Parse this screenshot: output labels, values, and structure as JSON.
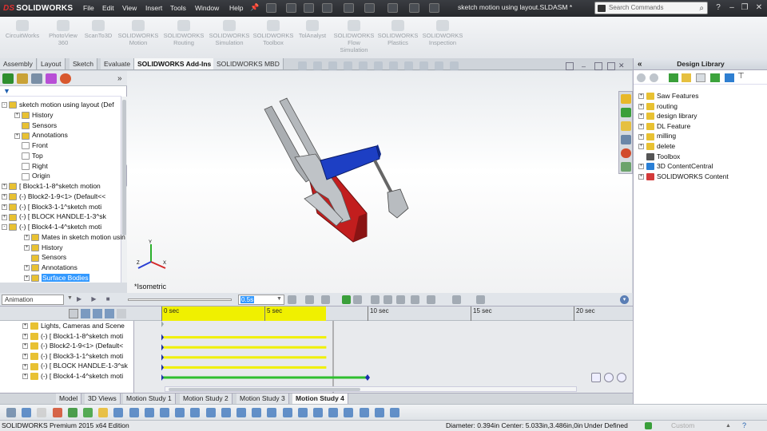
{
  "app": {
    "brand": "SOLIDWORKS",
    "brand_prefix": "DS",
    "doc_title": "sketch motion using layout.SLDASM *",
    "search_placeholder": "Search Commands",
    "menus": [
      "File",
      "Edit",
      "View",
      "Insert",
      "Tools",
      "Window",
      "Help"
    ]
  },
  "command_manager": {
    "items": [
      {
        "label1": "CircuitWorks",
        "label2": "",
        "label3": ""
      },
      {
        "label1": "PhotoView",
        "label2": "360",
        "label3": ""
      },
      {
        "label1": "ScanTo3D",
        "label2": "",
        "label3": ""
      },
      {
        "label1": "SOLIDWORKS",
        "label2": "Motion",
        "label3": ""
      },
      {
        "label1": "SOLIDWORKS",
        "label2": "Routing",
        "label3": ""
      },
      {
        "label1": "SOLIDWORKS",
        "label2": "Simulation",
        "label3": ""
      },
      {
        "label1": "SOLIDWORKS",
        "label2": "Toolbox",
        "label3": ""
      },
      {
        "label1": "TolAnalyst",
        "label2": "",
        "label3": ""
      },
      {
        "label1": "SOLIDWORKS",
        "label2": "Flow",
        "label3": "Simulation"
      },
      {
        "label1": "SOLIDWORKS",
        "label2": "Plastics",
        "label3": ""
      },
      {
        "label1": "SOLIDWORKS",
        "label2": "Inspection",
        "label3": ""
      }
    ],
    "tabs": [
      "Assembly",
      "Layout",
      "Sketch",
      "Evaluate",
      "SOLIDWORKS Add-Ins",
      "SOLIDWORKS MBD"
    ],
    "active_tab": "SOLIDWORKS Add-Ins"
  },
  "feature_tree": {
    "rows": [
      {
        "text": "sketch motion using layout  (Def",
        "indent": 0,
        "exp": "-",
        "color": "#e8c132"
      },
      {
        "text": "History",
        "indent": 1,
        "exp": "+",
        "color": "#e8c132"
      },
      {
        "text": "Sensors",
        "indent": 1,
        "exp": "",
        "color": "#e8c132"
      },
      {
        "text": "Annotations",
        "indent": 1,
        "exp": "+",
        "color": "#e8c132"
      },
      {
        "text": "Front",
        "indent": 1,
        "exp": "",
        "color": "#ffffff"
      },
      {
        "text": "Top",
        "indent": 1,
        "exp": "",
        "color": "#ffffff"
      },
      {
        "text": "Right",
        "indent": 1,
        "exp": "",
        "color": "#ffffff"
      },
      {
        "text": "Origin",
        "indent": 1,
        "exp": "",
        "color": "#ffffff"
      },
      {
        "text": "[ Block1-1-8^sketch motion",
        "indent": 0,
        "exp": "+",
        "color": "#e8c132"
      },
      {
        "text": "(-) Block2-1-9<1> (Default<<",
        "indent": 0,
        "exp": "+",
        "color": "#e8c132"
      },
      {
        "text": "(-) [ Block3-1-1^sketch moti",
        "indent": 0,
        "exp": "+",
        "color": "#e8c132"
      },
      {
        "text": "(-) [ BLOCK HANDLE-1-3^sk",
        "indent": 0,
        "exp": "+",
        "color": "#e8c132"
      },
      {
        "text": "(-) [ Block4-1-4^sketch moti",
        "indent": 0,
        "exp": "-",
        "color": "#e8c132"
      },
      {
        "text": "Mates in sketch motion usin",
        "indent": 2,
        "exp": "+",
        "color": "#e8c132"
      },
      {
        "text": "History",
        "indent": 2,
        "exp": "+",
        "color": "#e8c132"
      },
      {
        "text": "Sensors",
        "indent": 2,
        "exp": "",
        "color": "#e8c132"
      },
      {
        "text": "Annotations",
        "indent": 2,
        "exp": "+",
        "color": "#e8c132"
      },
      {
        "text": "Surface Bodies",
        "indent": 2,
        "exp": "+",
        "color": "#e8c132",
        "selected": true
      }
    ]
  },
  "viewport": {
    "view_name": "*Isometric"
  },
  "design_library": {
    "title": "Design Library",
    "items": [
      {
        "text": "Saw Features",
        "exp": "+",
        "color": "#e8c132"
      },
      {
        "text": "routing",
        "exp": "+",
        "color": "#e8c132"
      },
      {
        "text": "design library",
        "exp": "+",
        "color": "#e8c132"
      },
      {
        "text": "DL Feature",
        "exp": "+",
        "color": "#e8c132"
      },
      {
        "text": "milling",
        "exp": "+",
        "color": "#e8c132"
      },
      {
        "text": "delete",
        "exp": "+",
        "color": "#e8c132"
      },
      {
        "text": "Toolbox",
        "exp": "",
        "color": "#555555"
      },
      {
        "text": "3D ContentCentral",
        "exp": "+",
        "color": "#2a7fd6"
      },
      {
        "text": "SOLIDWORKS Content",
        "exp": "+",
        "color": "#d43a3a"
      }
    ]
  },
  "motion": {
    "study_type": "Animation",
    "speed_value": "0.5s",
    "ticks": [
      "0 sec",
      "5 sec",
      "10 sec",
      "15 sec",
      "20 sec"
    ],
    "rows": [
      "Lights, Cameras and Scene",
      "(-) [ Block1-1-8^sketch moti",
      "(-) Block2-1-9<1> (Default<",
      "(-) [ Block3-1-1^sketch moti",
      "(-) [ BLOCK HANDLE-1-3^sk",
      "(-) [ Block4-1-4^sketch moti"
    ],
    "study_tabs": [
      "Model",
      "3D Views",
      "Motion Study 1",
      "Motion Study 2",
      "Motion Study 3",
      "Motion Study 4"
    ],
    "active_study": "Motion Study 4"
  },
  "status": {
    "edition": "SOLIDWORKS Premium 2015 x64 Edition",
    "diameter": "Diameter: 0.394in  Center: 5.033in,3.486in,0in",
    "defined": "Under Defined",
    "custom": "Custom"
  },
  "colors": {
    "accent": "#3399ff",
    "block_red": "#c21e1e",
    "block_blue": "#1d3fc4",
    "timeline_yellow": "#f0f000",
    "timeline_green": "#2fbf2f",
    "key_blue": "#1b2fae"
  }
}
